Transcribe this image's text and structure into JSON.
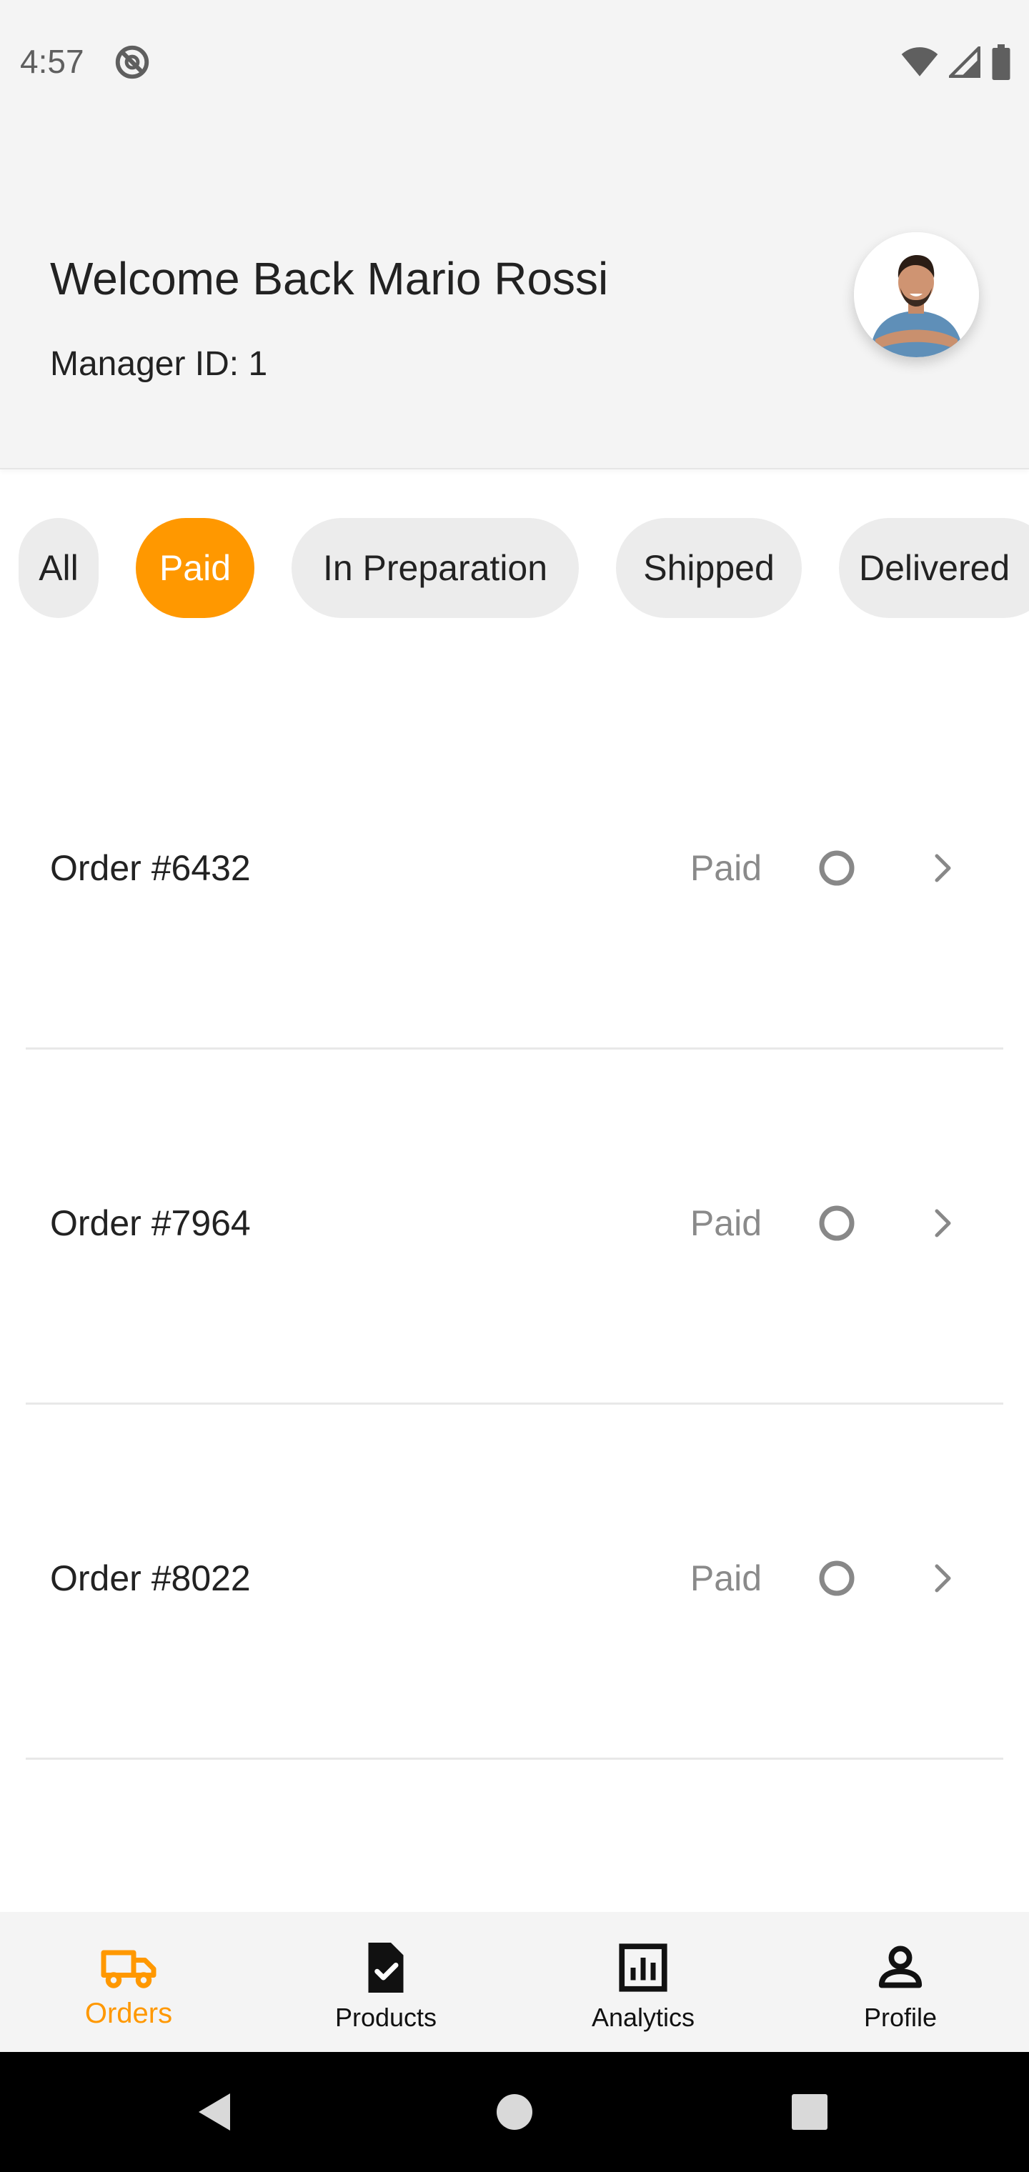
{
  "status_bar": {
    "time": "4:57",
    "icons": [
      "dnd-icon",
      "wifi-icon",
      "signal-icon",
      "battery-icon"
    ]
  },
  "header": {
    "welcome": "Welcome Back Mario Rossi",
    "manager_id": "Manager ID: 1",
    "avatar": "avatar"
  },
  "filters": {
    "active": "Paid",
    "items": [
      {
        "label": "All"
      },
      {
        "label": "Paid"
      },
      {
        "label": "In Preparation"
      },
      {
        "label": "Shipped"
      },
      {
        "label": "Delivered"
      }
    ]
  },
  "orders": [
    {
      "title": "Order #6432",
      "status": "Paid"
    },
    {
      "title": "Order #7964",
      "status": "Paid"
    },
    {
      "title": "Order #8022",
      "status": "Paid"
    }
  ],
  "bottom_nav": {
    "active": "Orders",
    "items": [
      {
        "label": "Orders",
        "icon": "truck-icon"
      },
      {
        "label": "Products",
        "icon": "document-check-icon"
      },
      {
        "label": "Analytics",
        "icon": "bar-chart-icon"
      },
      {
        "label": "Profile",
        "icon": "person-icon"
      }
    ]
  },
  "colors": {
    "accent": "#ff9800",
    "header_bg": "#f4f4f4",
    "chip_bg": "#ececec",
    "muted_text": "#8a8a8a"
  }
}
